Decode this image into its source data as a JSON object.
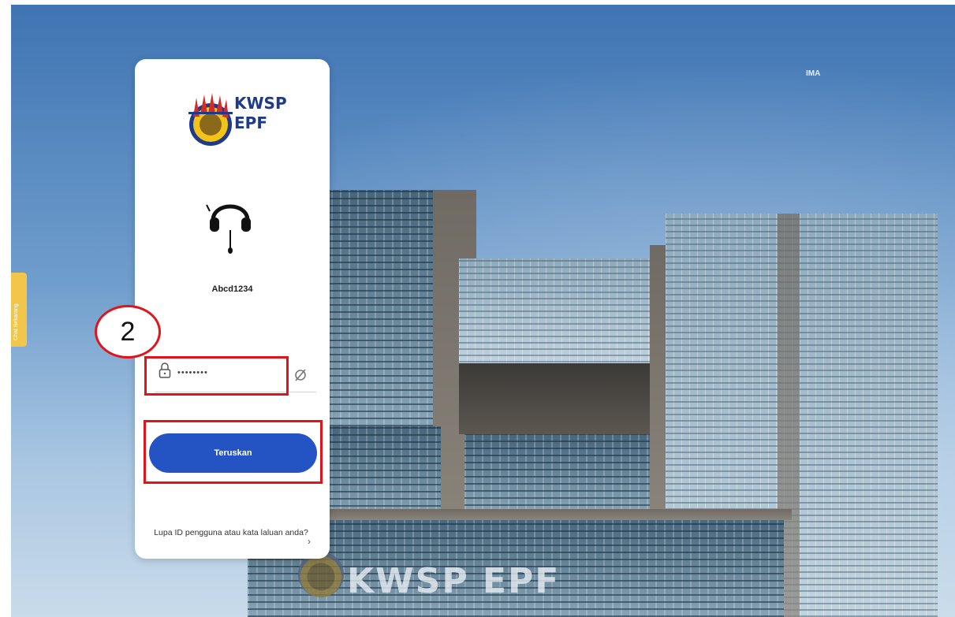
{
  "background": {
    "building_sign": "KWSP EPF",
    "top_right_text": "IMA",
    "side_tab_label": "Chat Sekarang"
  },
  "login": {
    "brand_line1": "KWSP",
    "brand_line2": "EPF",
    "username": "Abcd1234",
    "password_value": "••••••••",
    "continue_label": "Teruskan",
    "forgot_text": "Lupa ID pengguna atau kata laluan anda?",
    "chevron": "›"
  },
  "annotation": {
    "step_number": "2",
    "highlight_color": "#e0141b"
  },
  "colors": {
    "primary_button": "#2453c4",
    "brand_blue": "#1f3a8a"
  },
  "icons": [
    "kwsp-logo-icon",
    "headset-avatar-icon",
    "lock-icon",
    "eye-off-icon",
    "chevron-right-icon"
  ]
}
